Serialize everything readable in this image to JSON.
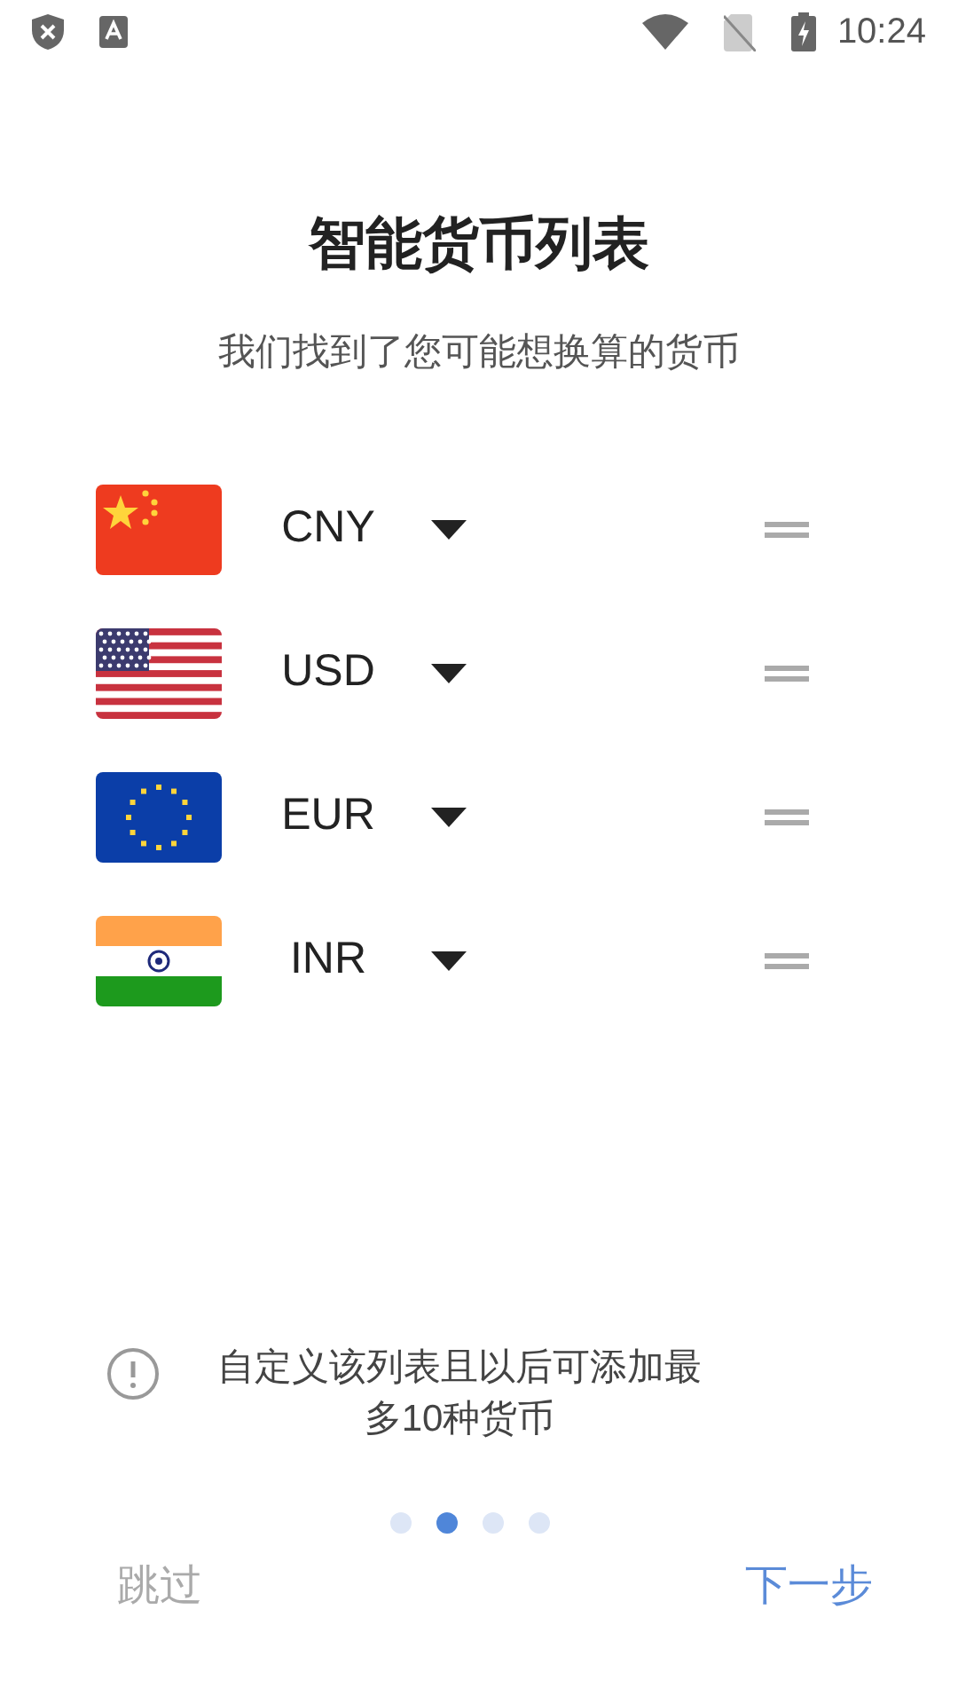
{
  "status_bar": {
    "time": "10:24"
  },
  "title": "智能货币列表",
  "subtitle": "我们找到了您可能想换算的货币",
  "currencies": [
    {
      "code": "CNY",
      "kind": "cn"
    },
    {
      "code": "USD",
      "kind": "us"
    },
    {
      "code": "EUR",
      "kind": "eu"
    },
    {
      "code": "INR",
      "kind": "in"
    }
  ],
  "info_text": "自定义该列表且以后可添加最多10种货币",
  "page_dots": [
    {
      "selected": false
    },
    {
      "selected": true
    },
    {
      "selected": false
    },
    {
      "selected": false
    }
  ],
  "skip_button": "跳过",
  "next_button": "下一步"
}
